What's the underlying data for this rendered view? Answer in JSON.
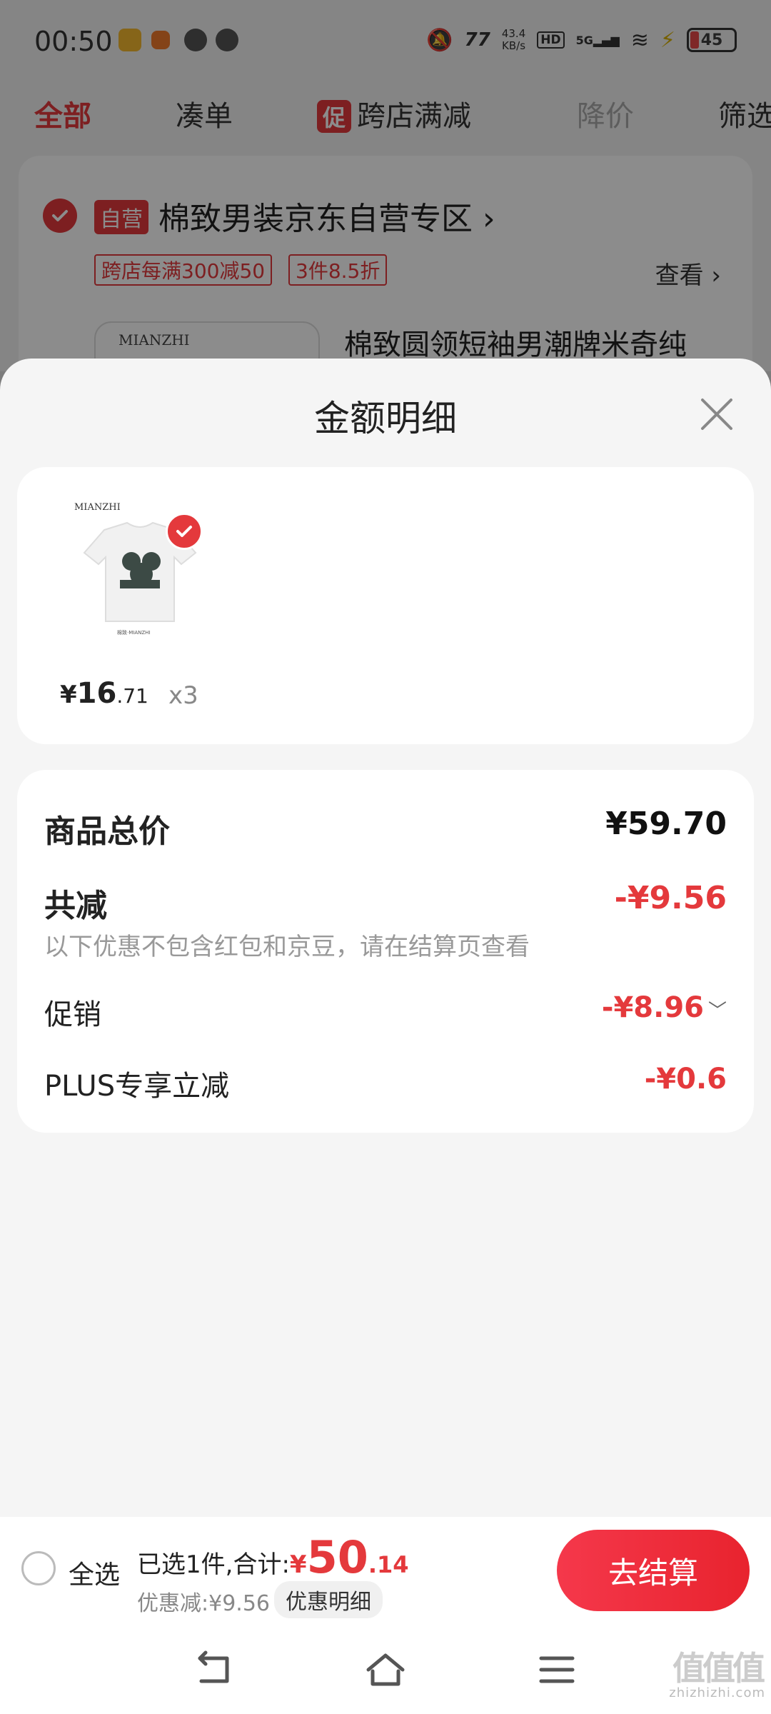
{
  "status_bar": {
    "time": "00:50",
    "net_speed_value": "43.4",
    "net_speed_unit": "KB/s",
    "hd": "HD",
    "signal": "5G",
    "battery": "45"
  },
  "tabs": [
    {
      "label": "全部",
      "state": "active"
    },
    {
      "label": "凑单",
      "state": "normal"
    },
    {
      "label": "跨店满减",
      "badge": "促",
      "state": "normal"
    },
    {
      "label": "降价",
      "state": "dim"
    },
    {
      "label": "筛选",
      "state": "normal"
    }
  ],
  "store": {
    "tag": "自营",
    "name": "棉致男装京东自营专区",
    "name_chevron": "›",
    "promo_tags": [
      "跨店每满300减50",
      "3件8.5折"
    ],
    "view_label": "查看",
    "view_chevron": "›",
    "thumb_brand": "MIANZHI",
    "product_title": "棉致圆领短袖男潮牌米奇纯"
  },
  "sheet": {
    "title": "金额明细",
    "item": {
      "brand": "MIANZHI",
      "caption": "棉致·MIANZHI",
      "price_yen": "¥",
      "price_int": "16",
      "price_dec": ".71",
      "quantity": "x3"
    },
    "rows": {
      "total_label": "商品总价",
      "total_value": "¥59.70",
      "reduce_label": "共减",
      "reduce_value": "-¥9.56",
      "reduce_note": "以下优惠不包含红包和京豆，请在结算页查看",
      "promo_label": "促销",
      "promo_value": "-¥8.96",
      "plus_label": "PLUS专享立减",
      "plus_value": "-¥0.6"
    }
  },
  "checkout": {
    "select_all": "全选",
    "selected_text": "已选1件,合计:",
    "total_yen": "¥",
    "total_int": "50",
    "total_dec": ".14",
    "discount_text": "优惠减:¥9.56",
    "discount_detail_btn": "优惠明细",
    "checkout_btn": "去结算"
  },
  "watermark": {
    "logo": "值值值",
    "url": "zhizhizhi.com"
  },
  "colors": {
    "accent_red": "#e4393c",
    "sheet_bg": "#f5f5f5"
  }
}
